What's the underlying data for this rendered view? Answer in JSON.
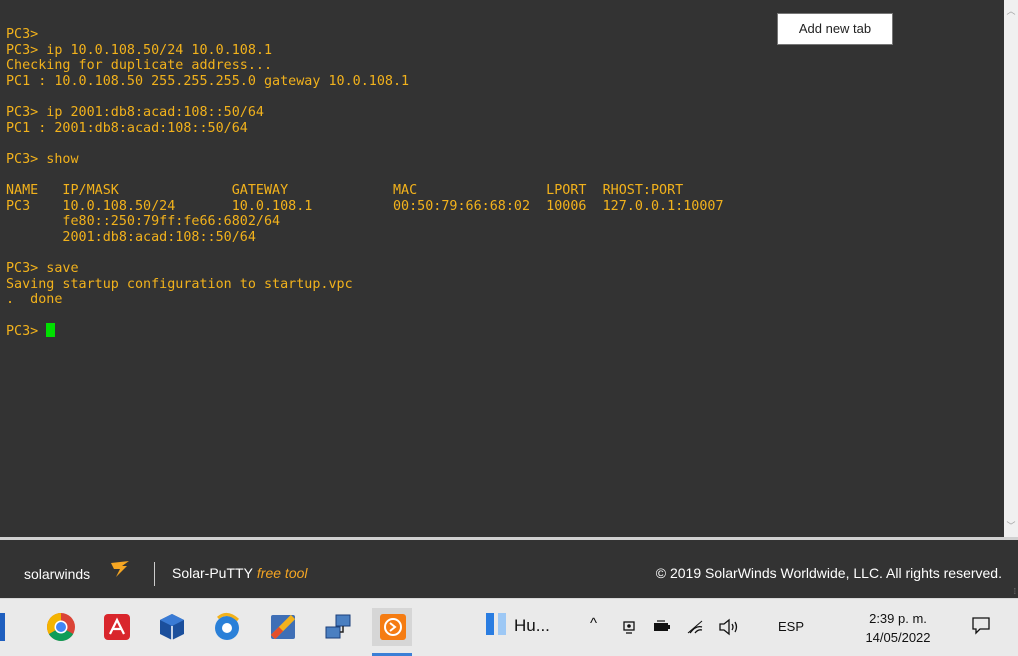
{
  "terminal": {
    "lines": "PC3>\nPC3> ip 10.0.108.50/24 10.0.108.1\nChecking for duplicate address...\nPC1 : 10.0.108.50 255.255.255.0 gateway 10.0.108.1\n\nPC3> ip 2001:db8:acad:108::50/64\nPC1 : 2001:db8:acad:108::50/64\n\nPC3> show\n\nNAME   IP/MASK              GATEWAY             MAC                LPORT  RHOST:PORT\nPC3    10.0.108.50/24       10.0.108.1          00:50:79:66:68:02  10006  127.0.0.1:10007\n       fe80::250:79ff:fe66:6802/64\n       2001:db8:acad:108::50/64\n\nPC3> save\nSaving startup configuration to startup.vpc\n.  done\n\n",
    "prompt": "PC3> ",
    "text_color": "#f2b21c",
    "cursor_color": "#00e000",
    "background": "#333333"
  },
  "tooltip": {
    "text": "Add new tab"
  },
  "footer": {
    "brand": "solarwinds",
    "product": "Solar-PuTTY",
    "product_tag": "free tool",
    "copyright": "© 2019 SolarWinds Worldwide, LLC. All rights reserved."
  },
  "taskbar": {
    "apps": [
      {
        "name": "chrome-icon"
      },
      {
        "name": "acrobat-icon"
      },
      {
        "name": "virtualbox-icon"
      },
      {
        "name": "browser-icon"
      },
      {
        "name": "paint-icon"
      },
      {
        "name": "network-icon"
      },
      {
        "name": "solar-putty-icon"
      }
    ],
    "search_app_label": "Hu...",
    "language": "ESP",
    "time": "2:39 p. m.",
    "date": "14/05/2022"
  }
}
